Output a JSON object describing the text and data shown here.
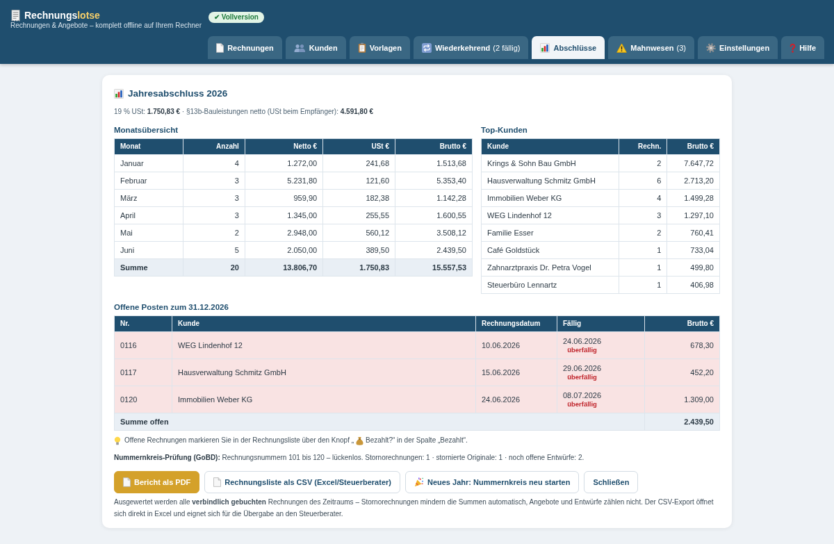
{
  "header": {
    "app_name": "Rechnungs",
    "app_name_accent": "lotse",
    "tagline": "Rechnungen & Angebote – komplett offline auf Ihrem Rechner",
    "license_badge": "✔ Vollversion"
  },
  "tabs": [
    {
      "label": "Rechnungen",
      "selected": false
    },
    {
      "label": "Kunden",
      "selected": false
    },
    {
      "label": "Vorlagen",
      "selected": false
    },
    {
      "label": "Wiederkehrend",
      "suffix": "(2 fällig)",
      "selected": false
    },
    {
      "label": "Abschlüsse",
      "selected": true
    },
    {
      "label": "Mahnwesen",
      "suffix": "(3)",
      "selected": false
    },
    {
      "label": "Einstellungen",
      "selected": false
    },
    {
      "label": "Hilfe",
      "selected": false
    }
  ],
  "report": {
    "title": "Jahresabschluss 2026",
    "summary": "19 % USt: **1.750,83 €**  ·  §13b-Bauleistungen netto (USt beim Empfänger): **4.591,80 €**",
    "monthly": {
      "heading": "Monatsübersicht",
      "columns": [
        "Monat",
        "Anzahl",
        "Netto €",
        "USt €",
        "Brutto €"
      ],
      "rows": [
        [
          "Januar",
          "4",
          "1.272,00",
          "241,68",
          "1.513,68"
        ],
        [
          "Februar",
          "3",
          "5.231,80",
          "121,60",
          "5.353,40"
        ],
        [
          "März",
          "3",
          "959,90",
          "182,38",
          "1.142,28"
        ],
        [
          "April",
          "3",
          "1.345,00",
          "255,55",
          "1.600,55"
        ],
        [
          "Mai",
          "2",
          "2.948,00",
          "560,12",
          "3.508,12"
        ],
        [
          "Juni",
          "5",
          "2.050,00",
          "389,50",
          "2.439,50"
        ]
      ],
      "total": [
        "Summe",
        "20",
        "13.806,70",
        "1.750,83",
        "15.557,53"
      ]
    },
    "top_customers": {
      "heading": "Top-Kunden",
      "columns": [
        "Kunde",
        "Rechn.",
        "Brutto €"
      ],
      "rows": [
        [
          "Krings & Sohn Bau GmbH",
          "2",
          "7.647,72"
        ],
        [
          "Hausverwaltung Schmitz GmbH",
          "6",
          "2.713,20"
        ],
        [
          "Immobilien Weber KG",
          "4",
          "1.499,28"
        ],
        [
          "WEG Lindenhof 12",
          "3",
          "1.297,10"
        ],
        [
          "Familie Esser",
          "2",
          "760,41"
        ],
        [
          "Café Goldstück",
          "1",
          "733,04"
        ],
        [
          "Zahnarztpraxis Dr. Petra Vogel",
          "1",
          "499,80"
        ],
        [
          "Steuerbüro Lennartz",
          "1",
          "406,98"
        ]
      ]
    },
    "open_items": {
      "heading": "Offene Posten zum 31.12.2026",
      "columns": [
        "Nr.",
        "Kunde",
        "Rechnungsdatum",
        "Fällig",
        "Brutto €"
      ],
      "rows": [
        {
          "number": "0116",
          "customer": "WEG Lindenhof 12",
          "invoice_date": "10.06.2026",
          "due": "24.06.2026",
          "status": "überfällig",
          "overdue": true,
          "gross": "678,30"
        },
        {
          "number": "0117",
          "customer": "Hausverwaltung Schmitz GmbH",
          "invoice_date": "15.06.2026",
          "due": "29.06.2026",
          "status": "überfällig",
          "overdue": true,
          "gross": "452,20"
        },
        {
          "number": "0120",
          "customer": "Immobilien Weber KG",
          "invoice_date": "24.06.2026",
          "due": "08.07.2026",
          "status": "überfällig",
          "overdue": true,
          "gross": "1.309,00"
        }
      ],
      "total_label": "Summe offen",
      "total": "2.439,50"
    },
    "note": {
      "before": "Offene Rechnungen markieren Sie in der Rechnungsliste über den Knopf „",
      "after": "Bezahlt?“ in der Spalte „Bezahlt“."
    },
    "sequence_check": "**Nummernkreis-Prüfung (GoBD):** Rechnungsnummern 101 bis 120 – lückenlos. Stornorechnungen: 1 · stornierte Originale: 1 · noch offene Entwürfe: 2.",
    "buttons": [
      {
        "label": "Bericht als PDF",
        "kind": "primary"
      },
      {
        "label": "Rechnungsliste als CSV (Excel/Steuerberater)",
        "kind": "secondary"
      },
      {
        "label": "Neues Jahr: Nummernkreis neu starten",
        "kind": "secondary"
      },
      {
        "label": "Schließen",
        "kind": "secondary"
      }
    ],
    "footnote": "Ausgewertet werden alle **verbindlich gebuchten** Rechnungen des Zeitraums – Stornorechnungen mindern die Summen automatisch, Angebote und Entwürfe zählen nicht. Der CSV-Export öffnet sich direkt in Excel und eignet sich für die Übergabe an den Steuerberater."
  }
}
